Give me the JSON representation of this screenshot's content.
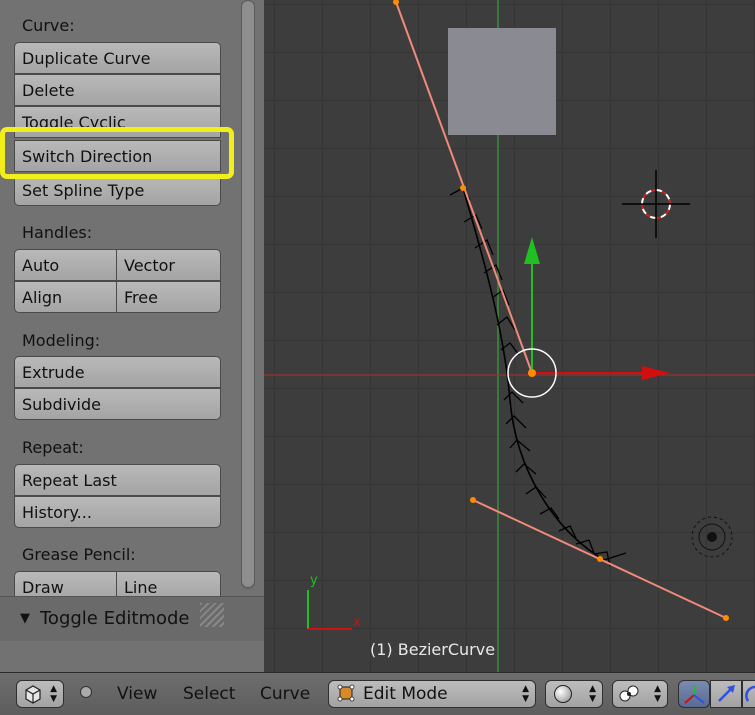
{
  "shelf": {
    "sections": {
      "curve": "Curve:",
      "handles": "Handles:",
      "modeling": "Modeling:",
      "repeat": "Repeat:",
      "grease": "Grease Pencil:"
    },
    "curve_buttons": [
      "Duplicate Curve",
      "Delete",
      "Toggle Cyclic",
      "Switch Direction",
      "Set Spline Type"
    ],
    "handle_buttons": [
      "Auto",
      "Vector",
      "Align",
      "Free"
    ],
    "modeling_buttons": [
      "Extrude",
      "Subdivide"
    ],
    "repeat_buttons": [
      "Repeat Last",
      "History..."
    ],
    "grease_buttons": [
      "Draw",
      "Line"
    ],
    "toggle_editmode": "Toggle Editmode"
  },
  "viewport": {
    "object_label": "(1) BezierCurve",
    "axis_y": "y",
    "axis_x": "x",
    "colors": {
      "curve": "#000000",
      "handle_line": "#f08a7a",
      "handle_point": "#ff8c00",
      "x_axis": "#d01010",
      "y_axis": "#20c020",
      "grid": "#353535"
    }
  },
  "header": {
    "menus": [
      "View",
      "Select",
      "Curve"
    ],
    "mode": "Edit Mode",
    "icons": [
      "cube-editor-icon",
      "mode-icon",
      "shading-sphere-icon",
      "pivot-icon",
      "manipulator-icon"
    ]
  },
  "highlight_color": "#f2ee1a"
}
